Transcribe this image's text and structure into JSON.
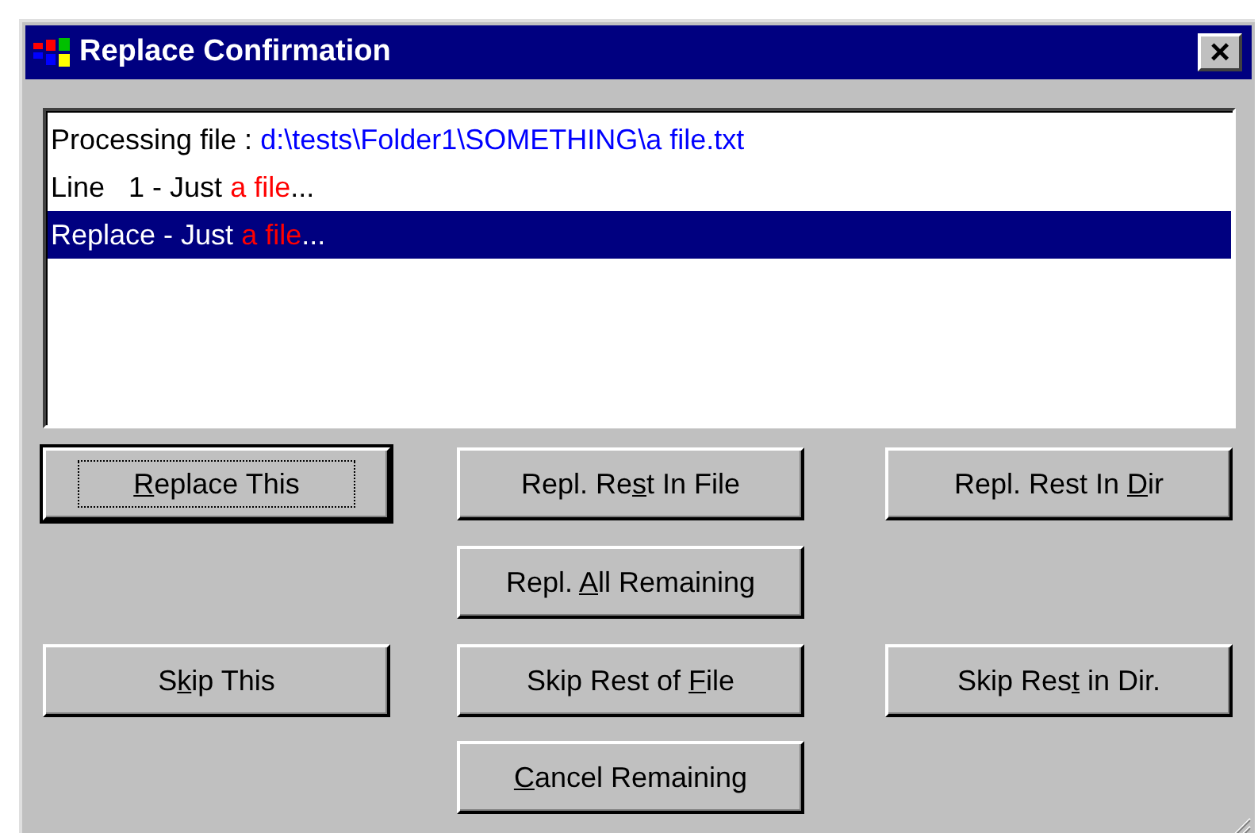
{
  "window": {
    "title": "Replace Confirmation",
    "close": "×"
  },
  "log": [
    {
      "selected": false,
      "segments": [
        {
          "kind": "plain",
          "text": "Processing file : "
        },
        {
          "kind": "path",
          "text": "d:\\tests\\Folder1\\SOMETHING\\a file.txt"
        }
      ]
    },
    {
      "selected": false,
      "segments": [
        {
          "kind": "plain",
          "text": "Line   1 - Just "
        },
        {
          "kind": "match",
          "text": "a file"
        },
        {
          "kind": "plain",
          "text": "..."
        }
      ]
    },
    {
      "selected": true,
      "segments": [
        {
          "kind": "plain",
          "text": "Replace - Just "
        },
        {
          "kind": "match",
          "text": "a file"
        },
        {
          "kind": "plain",
          "text": "..."
        }
      ]
    }
  ],
  "button_rows": [
    [
      {
        "kind": "left",
        "key": "R",
        "post": "eplace This",
        "default": true
      },
      {
        "kind": "center",
        "pre": "Repl. Re",
        "key": "s",
        "post": "t In File",
        "default": false
      },
      {
        "kind": "right",
        "pre": "Repl. Rest In ",
        "key": "D",
        "post": "ir",
        "default": false
      }
    ],
    [
      {
        "kind": "center",
        "pre": "Repl. ",
        "key": "A",
        "post": "ll Remaining",
        "default": false
      }
    ],
    [
      {
        "kind": "left",
        "pre": "S",
        "key": "k",
        "post": "ip This",
        "default": false
      },
      {
        "kind": "center",
        "pre": "Skip Rest of ",
        "key": "F",
        "post": "ile",
        "default": false
      },
      {
        "kind": "right",
        "pre": "Skip Res",
        "key": "t",
        "post": " in Dir.",
        "default": false
      }
    ],
    [
      {
        "kind": "center",
        "key": "C",
        "post": "ancel Remaining",
        "default": false
      }
    ]
  ]
}
